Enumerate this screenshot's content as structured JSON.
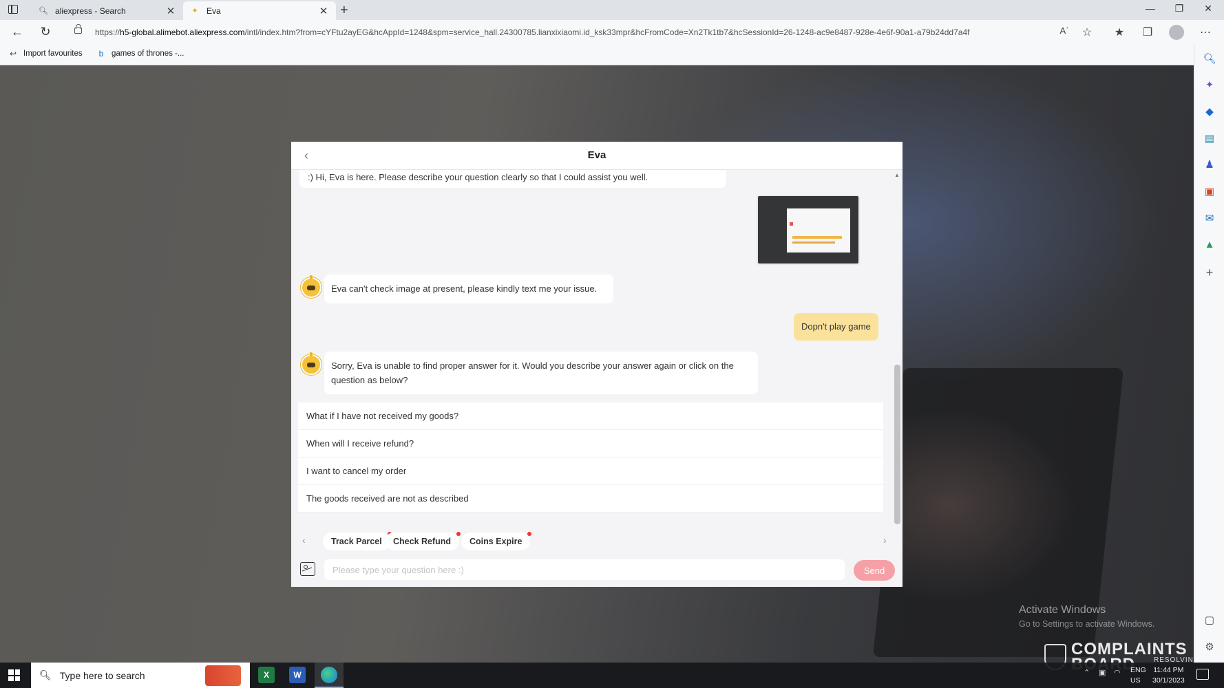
{
  "browser": {
    "tabs": [
      {
        "label": "aliexpress - Search",
        "icon": "search-icon",
        "active": false
      },
      {
        "label": "Eva",
        "icon": "eva-favicon",
        "active": true
      }
    ],
    "url_domain": "h5-global.alimebot.aliexpress.com",
    "url_prefix": "https://",
    "url_path": "/intl/index.htm?from=cYFtu2ayEG&hcAppId=1248&spm=service_hall.24300785.lianxixiaomi.id_ksk33mpr&hcFromCode=Xn2Tk1tb7&hcSessionId=26-1248-ac9e8487-928e-4e6f-90a1-a79b24dd7a4f",
    "favourites": [
      {
        "label": "Import favourites",
        "icon": "import-icon"
      },
      {
        "label": "games of thrones -...",
        "icon": "bing-icon"
      }
    ]
  },
  "chat": {
    "title": "Eva",
    "messages": {
      "greeting": ":) Hi, Eva is here. Please describe your question clearly so that I could assist you well.",
      "eva_image_reply": "Eva can't check image at present, please kindly text me your issue.",
      "user_text": "Dopn't play game",
      "eva_no_answer": "Sorry, Eva is unable to find proper answer for it. Would you describe your answer again or click on the question as below?"
    },
    "faq": [
      "What if I have not received my goods?",
      "When will I receive refund?",
      "I want to cancel my order",
      "The goods received are not as described"
    ],
    "quick_actions": [
      "Track Parcel",
      "Check Refund",
      "Coins Expire"
    ],
    "input_placeholder": "Please type your question here :)",
    "send_label": "Send"
  },
  "overlay": {
    "activate_title": "Activate Windows",
    "activate_sub": "Go to Settings to activate Windows.",
    "logo_line1": "COMPLAINTS",
    "logo_line2": "BOARD",
    "logo_tag": "RESOLVING"
  },
  "taskbar": {
    "search_placeholder": "Type here to search",
    "apps": [
      "excel-icon",
      "word-icon",
      "edge-icon"
    ],
    "lang_line1": "ENG",
    "lang_line2": "US",
    "time": "11:44 PM",
    "date": "30/1/2023"
  },
  "colors": {
    "user_bubble": "#fbe29a",
    "send_button": "#f4a0a6",
    "red_dot": "#ee3333"
  }
}
